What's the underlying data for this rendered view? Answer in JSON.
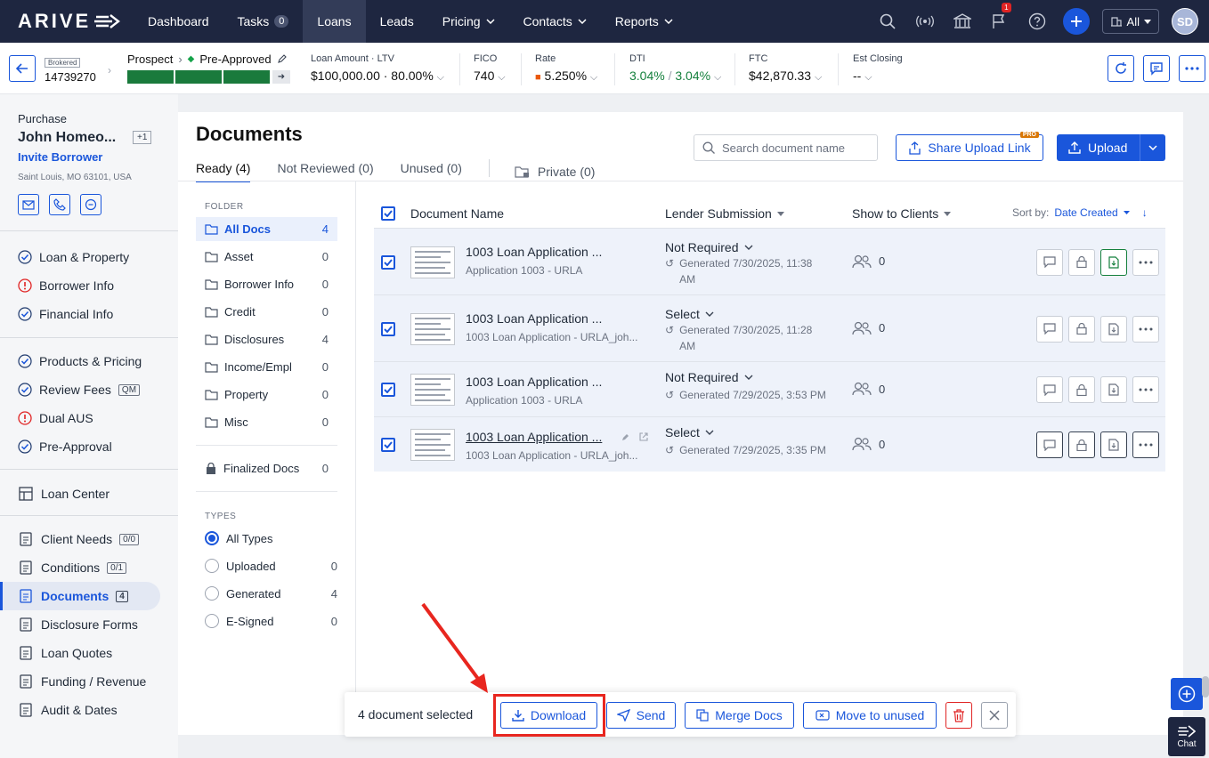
{
  "nav": {
    "logo": "ARIVE",
    "items": [
      "Dashboard",
      "Tasks",
      "Loans",
      "Leads",
      "Pricing",
      "Contacts",
      "Reports"
    ],
    "tasks_count": "0",
    "notif_count": "1",
    "scope": "All",
    "user_initials": "SD"
  },
  "loan": {
    "brokered": "Brokered",
    "number": "14739270",
    "stage_from": "Prospect",
    "stage_to": "Pre-Approved",
    "amount_label": "Loan Amount · LTV",
    "amount_value": "$100,000.00 · 80.00%",
    "fico_label": "FICO",
    "fico_value": "740",
    "rate_label": "Rate",
    "rate_value": "5.250%",
    "dti_label": "DTI",
    "dti_front": "3.04%",
    "dti_sep": "/",
    "dti_back": "3.04%",
    "ftc_label": "FTC",
    "ftc_value": "$42,870.33",
    "close_label": "Est Closing",
    "close_value": "--"
  },
  "borrower": {
    "type": "Purchase",
    "name": "John Homeo...",
    "extra": "+1",
    "invite": "Invite Borrower",
    "address": "Saint Louis, MO 63101, USA"
  },
  "sidebar": {
    "group1": [
      {
        "label": "Loan & Property",
        "status": "check"
      },
      {
        "label": "Borrower Info",
        "status": "warn"
      },
      {
        "label": "Financial Info",
        "status": "check"
      }
    ],
    "group2": [
      {
        "label": "Products & Pricing",
        "status": "check"
      },
      {
        "label": "Review Fees",
        "status": "check",
        "tag": "QM"
      },
      {
        "label": "Dual AUS",
        "status": "warn"
      },
      {
        "label": "Pre-Approval",
        "status": "check"
      }
    ],
    "loan_center": "Loan Center",
    "group3": [
      {
        "label": "Client Needs",
        "tag": "0/0"
      },
      {
        "label": "Conditions",
        "tag": "0/1"
      },
      {
        "label": "Documents",
        "tag": "4"
      },
      {
        "label": "Disclosure Forms"
      },
      {
        "label": "Loan Quotes"
      },
      {
        "label": "Funding / Revenue"
      },
      {
        "label": "Audit & Dates"
      }
    ]
  },
  "documents": {
    "title": "Documents",
    "tabs": [
      "Ready (4)",
      "Not Reviewed (0)",
      "Unused (0)",
      "Private (0)"
    ],
    "search_placeholder": "Search document name",
    "share_label": "Share Upload Link",
    "pro": "PRO",
    "upload_label": "Upload",
    "folder_heading": "FOLDER",
    "folders": [
      {
        "name": "All Docs",
        "count": "4"
      },
      {
        "name": "Asset",
        "count": "0"
      },
      {
        "name": "Borrower Info",
        "count": "0"
      },
      {
        "name": "Credit",
        "count": "0"
      },
      {
        "name": "Disclosures",
        "count": "4"
      },
      {
        "name": "Income/Empl",
        "count": "0"
      },
      {
        "name": "Property",
        "count": "0"
      },
      {
        "name": "Misc",
        "count": "0"
      }
    ],
    "finalized": {
      "name": "Finalized Docs",
      "count": "0"
    },
    "types_heading": "TYPES",
    "types": [
      {
        "name": "All Types",
        "count": ""
      },
      {
        "name": "Uploaded",
        "count": "0"
      },
      {
        "name": "Generated",
        "count": "4"
      },
      {
        "name": "E-Signed",
        "count": "0"
      }
    ],
    "columns": {
      "name": "Document Name",
      "lender": "Lender Submission",
      "clients": "Show to Clients",
      "sort_label": "Sort by:",
      "sort_value": "Date Created"
    },
    "rows": [
      {
        "name": "1003 Loan Application ...",
        "sub": "Application 1003 - URLA",
        "lender": "Not Required",
        "gen1": "Generated 7/30/2025, 11:38",
        "gen2": "AM",
        "clients": "0"
      },
      {
        "name": "1003 Loan Application ...",
        "sub": "1003 Loan Application - URLA_joh...",
        "lender": "Select",
        "gen1": "Generated 7/30/2025, 11:28",
        "gen2": "AM",
        "clients": "0"
      },
      {
        "name": "1003 Loan Application ...",
        "sub": "Application 1003 - URLA",
        "lender": "Not Required",
        "gen1": "Generated 7/29/2025, 3:53 PM",
        "gen2": "",
        "clients": "0"
      },
      {
        "name": "1003 Loan Application ...",
        "sub": "1003 Loan Application - URLA_joh...",
        "lender": "Select",
        "gen1": "Generated 7/29/2025, 3:35 PM",
        "gen2": "",
        "clients": "0"
      }
    ]
  },
  "bulk": {
    "selected": "4 document selected",
    "download": "Download",
    "send": "Send",
    "merge": "Merge Docs",
    "move": "Move to unused"
  },
  "chat_label": "Chat",
  "colors": {
    "accent": "#1a56db",
    "nav_bg": "#1e2640",
    "success": "#15803d",
    "warning": "#e02424"
  }
}
